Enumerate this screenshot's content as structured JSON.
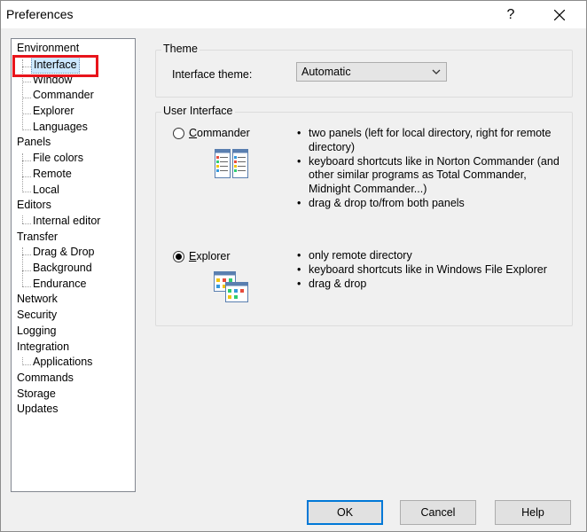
{
  "window": {
    "title": "Preferences",
    "help_glyph": "?",
    "close_glyph": "✕"
  },
  "tree": {
    "items": [
      {
        "label": "Environment",
        "level": 0
      },
      {
        "label": "Interface",
        "level": 1,
        "selected": true
      },
      {
        "label": "Window",
        "level": 1
      },
      {
        "label": "Commander",
        "level": 1
      },
      {
        "label": "Explorer",
        "level": 1
      },
      {
        "label": "Languages",
        "level": 1
      },
      {
        "label": "Panels",
        "level": 0
      },
      {
        "label": "File colors",
        "level": 1
      },
      {
        "label": "Remote",
        "level": 1
      },
      {
        "label": "Local",
        "level": 1
      },
      {
        "label": "Editors",
        "level": 0
      },
      {
        "label": "Internal editor",
        "level": 1
      },
      {
        "label": "Transfer",
        "level": 0
      },
      {
        "label": "Drag & Drop",
        "level": 1
      },
      {
        "label": "Background",
        "level": 1
      },
      {
        "label": "Endurance",
        "level": 1
      },
      {
        "label": "Network",
        "level": 0
      },
      {
        "label": "Security",
        "level": 0
      },
      {
        "label": "Logging",
        "level": 0
      },
      {
        "label": "Integration",
        "level": 0
      },
      {
        "label": "Applications",
        "level": 1
      },
      {
        "label": "Commands",
        "level": 0
      },
      {
        "label": "Storage",
        "level": 0
      },
      {
        "label": "Updates",
        "level": 0
      }
    ]
  },
  "theme": {
    "group_title": "Theme",
    "label": "Interface theme:",
    "value": "Automatic"
  },
  "user_interface": {
    "group_title": "User Interface",
    "commander": {
      "label": "Commander",
      "mnemonic": "C",
      "selected": false,
      "bullets": [
        "two panels (left for local directory, right for remote directory)",
        "keyboard shortcuts like in Norton Commander (and other similar programs as Total Commander, Midnight Commander...)",
        "drag & drop to/from both panels"
      ]
    },
    "explorer": {
      "label": "Explorer",
      "mnemonic": "E",
      "selected": true,
      "bullets": [
        "only remote directory",
        "keyboard shortcuts like in Windows File Explorer",
        "drag & drop"
      ]
    }
  },
  "buttons": {
    "ok": "OK",
    "cancel": "Cancel",
    "help": "Help"
  },
  "colors": {
    "highlight": "#e8141b",
    "selection": "#cce8ff",
    "accent": "#0078d7"
  }
}
